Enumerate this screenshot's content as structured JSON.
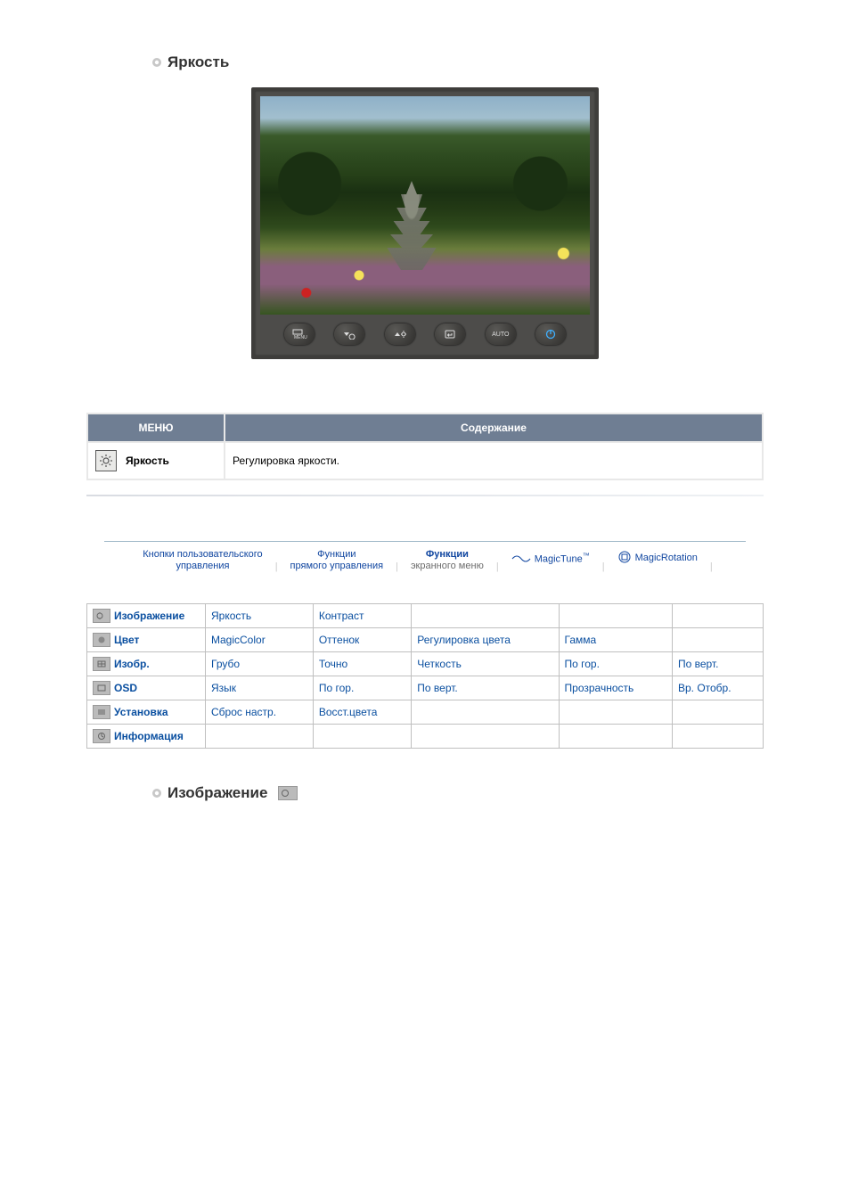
{
  "sections": {
    "brightness_title": "Яркость",
    "image_section_title": "Изображение"
  },
  "monitor_buttons": {
    "menu": "MENU",
    "down": "▾",
    "up_bright": "☼",
    "enter": "⏎",
    "auto": "AUTO",
    "power": "⏻"
  },
  "menu_table": {
    "header_menu": "МЕНЮ",
    "header_content": "Содержание",
    "rows": [
      {
        "label": "Яркость",
        "desc": "Регулировка яркости."
      }
    ]
  },
  "tabs": {
    "tab1_line1": "Кнопки пользовательского",
    "tab1_line2": "управления",
    "tab2_line1": "Функции",
    "tab2_line2": "прямого управления",
    "tab3_line1": "Функции",
    "tab3_line2": "экранного меню",
    "tab4_label": "MagicTune",
    "tab4_tm": "™",
    "tab5_label": "MagicRotation"
  },
  "grid": [
    {
      "cat": "Изображение",
      "items": [
        "Яркость",
        "Контраст",
        "",
        "",
        ""
      ]
    },
    {
      "cat": "Цвет",
      "items": [
        "MagicColor",
        "Оттенок",
        "Регулировка цвета",
        "Гамма",
        ""
      ]
    },
    {
      "cat": "Изобр.",
      "items": [
        "Грубо",
        "Точно",
        "Четкость",
        "По гор.",
        "По верт."
      ]
    },
    {
      "cat": "OSD",
      "items": [
        "Язык",
        "По гор.",
        "По верт.",
        "Прозрачность",
        "Вр. Отобр."
      ]
    },
    {
      "cat": "Установка",
      "items": [
        "Сброс настр.",
        "Восст.цвета",
        "",
        "",
        ""
      ]
    },
    {
      "cat": "Информация",
      "items": [
        "",
        "",
        "",
        "",
        ""
      ]
    }
  ]
}
